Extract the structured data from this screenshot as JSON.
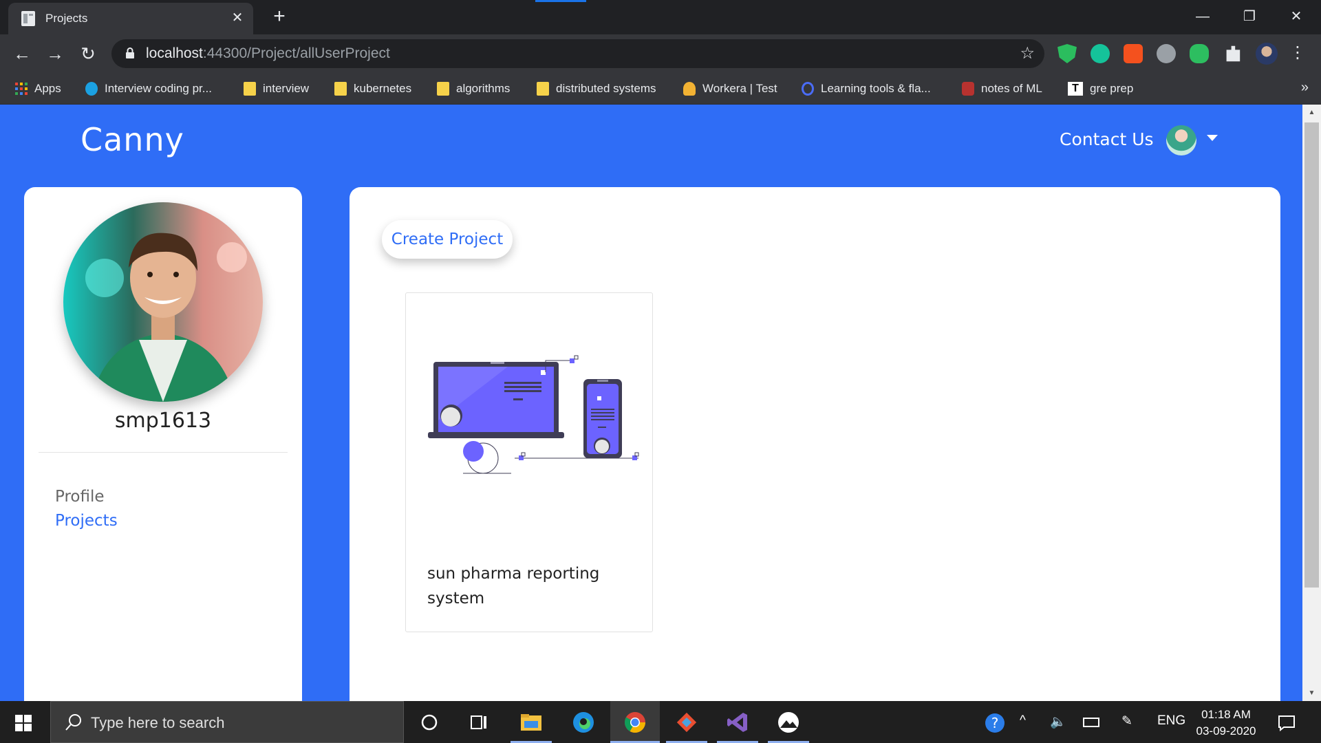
{
  "browser": {
    "tab_title": "Projects",
    "url_host": "localhost",
    "url_path": ":44300/Project/allUserProject",
    "bookmarks": [
      {
        "label": "Apps",
        "icon": "apps-grid-icon"
      },
      {
        "label": "Interview coding pr...",
        "icon": "site-icon"
      },
      {
        "label": "interview",
        "icon": "folder-icon"
      },
      {
        "label": "kubernetes",
        "icon": "folder-icon"
      },
      {
        "label": "algorithms",
        "icon": "folder-icon"
      },
      {
        "label": "distributed systems",
        "icon": "folder-icon"
      },
      {
        "label": "Workera | Test",
        "icon": "site-icon"
      },
      {
        "label": "Learning tools & fla...",
        "icon": "site-icon"
      },
      {
        "label": "notes of ML",
        "icon": "site-icon"
      },
      {
        "label": "gre prep",
        "icon": "site-icon"
      }
    ]
  },
  "header": {
    "brand": "Canny",
    "contact": "Contact Us"
  },
  "sidebar": {
    "username": "smp1613",
    "links": {
      "profile": "Profile",
      "projects": "Projects"
    }
  },
  "main": {
    "create_button": "Create Project",
    "projects": [
      {
        "name": "sun pharma reporting system"
      }
    ]
  },
  "taskbar": {
    "search_placeholder": "Type here to search",
    "language": "ENG",
    "time": "01:18 AM",
    "date": "03-09-2020"
  },
  "colors": {
    "page_bg": "#2f6df6",
    "accent": "#2f6df6",
    "illustration": "#6c63ff"
  }
}
